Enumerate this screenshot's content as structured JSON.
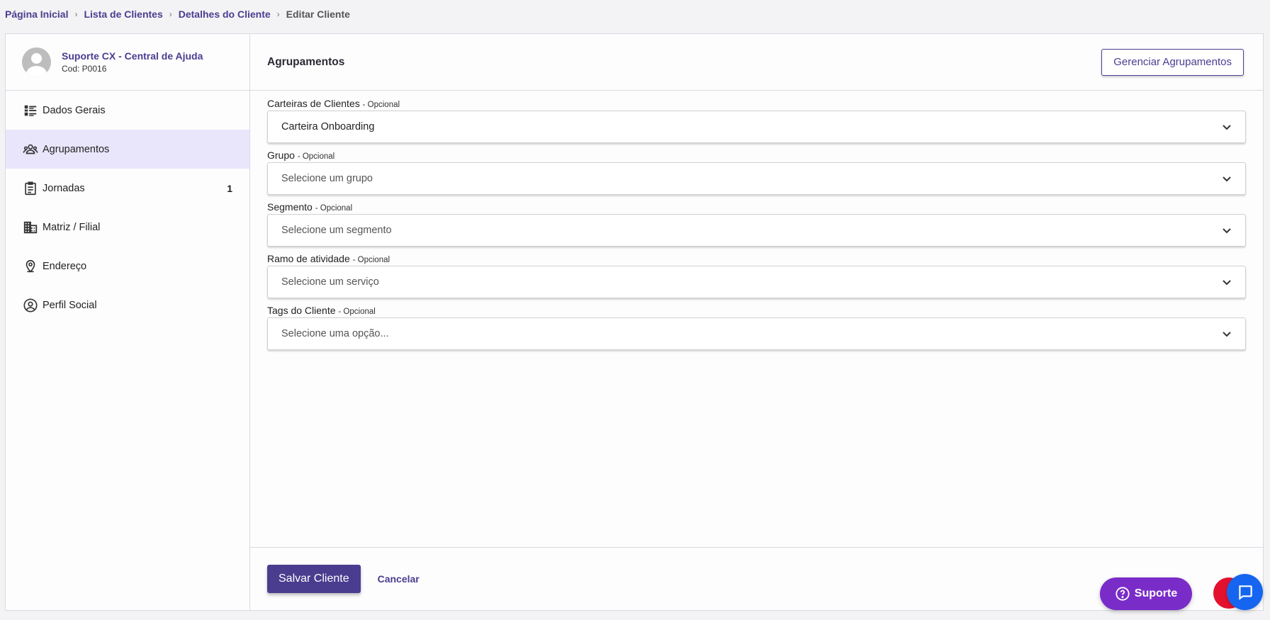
{
  "breadcrumb": {
    "items": [
      "Página Inicial",
      "Lista de Clientes",
      "Detalhes do Cliente"
    ],
    "current": "Editar Cliente"
  },
  "client": {
    "name": "Suporte CX - Central de Ajuda",
    "code": "Cod: P0016"
  },
  "sidebar": {
    "items": [
      {
        "label": "Dados Gerais",
        "icon": "list-icon"
      },
      {
        "label": "Agrupamentos",
        "icon": "groups-icon",
        "active": true
      },
      {
        "label": "Jornadas",
        "icon": "clipboard-icon",
        "badge": "1"
      },
      {
        "label": "Matriz / Filial",
        "icon": "building-icon"
      },
      {
        "label": "Endereço",
        "icon": "location-pin-icon"
      },
      {
        "label": "Perfil Social",
        "icon": "account-circle-icon"
      }
    ]
  },
  "main": {
    "title": "Agrupamentos",
    "manage_button": "Gerenciar Agrupamentos",
    "fields": [
      {
        "label": "Carteiras de Clientes",
        "optional": "- Opcional",
        "value": "Carteira Onboarding",
        "is_placeholder": false
      },
      {
        "label": "Grupo",
        "optional": "- Opcional",
        "value": "Selecione um grupo",
        "is_placeholder": true
      },
      {
        "label": "Segmento",
        "optional": "- Opcional",
        "value": "Selecione um segmento",
        "is_placeholder": true
      },
      {
        "label": "Ramo de atividade",
        "optional": "- Opcional",
        "value": "Selecione um serviço",
        "is_placeholder": true
      },
      {
        "label": "Tags do Cliente",
        "optional": "- Opcional",
        "value": "Selecione uma opção...",
        "is_placeholder": true
      }
    ]
  },
  "footer": {
    "save": "Salvar Cliente",
    "cancel": "Cancelar"
  },
  "support_button": "Suporte",
  "colors": {
    "brand": "#4a3d8f",
    "active_bg": "#e9e6fc",
    "support": "#7a2cc8",
    "chat": "#1665f0",
    "fab_red": "#e4112e"
  }
}
